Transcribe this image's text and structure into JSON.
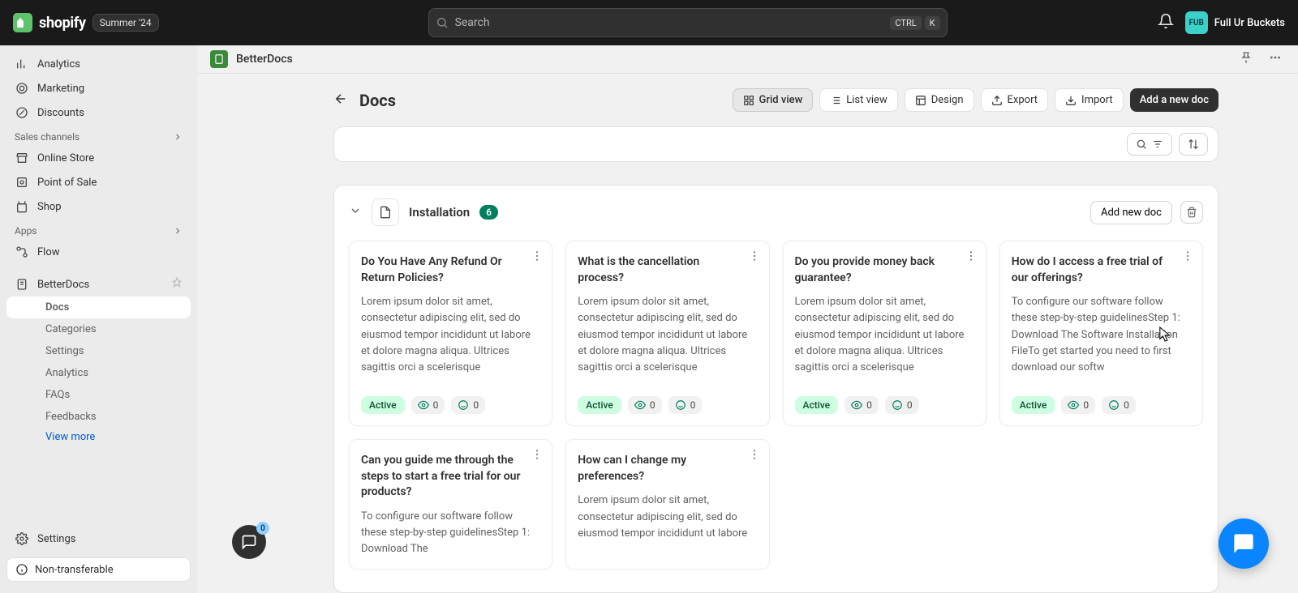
{
  "topbar": {
    "brand": "shopify",
    "season_badge": "Summer '24",
    "search_placeholder": "Search",
    "kbd1": "CTRL",
    "kbd2": "K",
    "user_initials": "FUB",
    "user_name": "Full Ur Buckets"
  },
  "sidebar": {
    "items_top": [
      {
        "icon": "analytics",
        "label": "Analytics"
      },
      {
        "icon": "marketing",
        "label": "Marketing"
      },
      {
        "icon": "discounts",
        "label": "Discounts"
      }
    ],
    "channels_header": "Sales channels",
    "channels": [
      {
        "icon": "onlinestore",
        "label": "Online Store"
      },
      {
        "icon": "pos",
        "label": "Point of Sale"
      },
      {
        "icon": "shop",
        "label": "Shop"
      }
    ],
    "apps_header": "Apps",
    "apps": [
      {
        "icon": "flow",
        "label": "Flow"
      }
    ],
    "betterdocs": "BetterDocs",
    "betterdocs_children": [
      {
        "label": "Docs",
        "active": true
      },
      {
        "label": "Categories"
      },
      {
        "label": "Settings"
      },
      {
        "label": "Analytics"
      },
      {
        "label": "FAQs"
      },
      {
        "label": "Feedbacks"
      }
    ],
    "view_more": "View more",
    "settings": "Settings",
    "non_transferable": "Non-transferable"
  },
  "app_header": {
    "title": "BetterDocs"
  },
  "page": {
    "title": "Docs",
    "toolbar": {
      "grid": "Grid view",
      "list": "List view",
      "design": "Design",
      "export": "Export",
      "import": "Import",
      "add": "Add a new doc"
    }
  },
  "section": {
    "title": "Installation",
    "count": "6",
    "add": "Add new doc"
  },
  "lorem": "Lorem ipsum dolor sit amet, consectetur adipiscing elit, sed do eiusmod tempor incididunt ut labore et dolore magna aliqua. Ultrices sagittis orci a scelerisque",
  "software_body": "To configure our software follow these step-by-step guidelinesStep 1: Download The Software Installation FileTo get started you need to first download our softw",
  "software_body_cut": "To configure our software follow these step-by-step guidelinesStep 1: Download The",
  "lorem_cut": "Lorem ipsum dolor sit amet, consectetur adipiscing elit, sed do eiusmod tempor incididunt ut labore et dolore magna aliqua.",
  "docs": [
    {
      "title": "Do You Have Any Refund Or Return Policies?",
      "body_key": "lorem"
    },
    {
      "title": "What is the cancellation process?",
      "body_key": "lorem"
    },
    {
      "title": "Do you provide money back guarantee?",
      "body_key": "lorem"
    },
    {
      "title": "How do I access a free trial of our offerings?",
      "body_key": "software_body"
    },
    {
      "title": "Can you guide me through the steps to start a free trial for our products?",
      "body_key": "software_body_cut"
    },
    {
      "title": "How can I change my preferences?",
      "body_key": "lorem_cut"
    }
  ],
  "status_label": "Active",
  "stat_zero": "0",
  "chat_badge": "0"
}
